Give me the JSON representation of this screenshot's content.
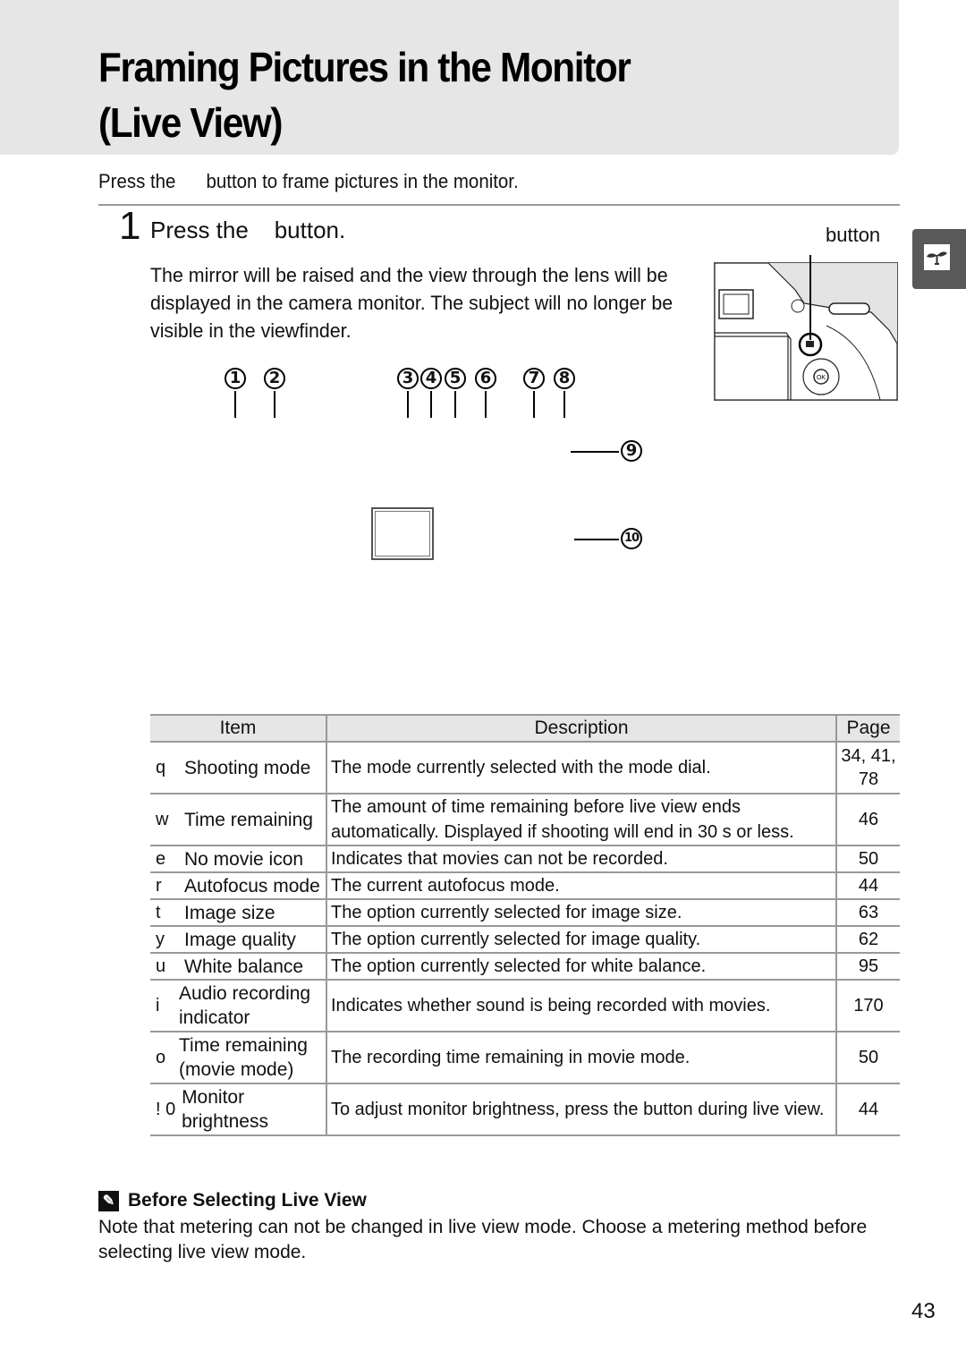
{
  "header": {
    "title_line1": "Framing Pictures in the Monitor",
    "title_line2": "(Live View)"
  },
  "intro": "Press the      button to frame pictures in the monitor.",
  "step": {
    "number": "1",
    "heading": "Press the    button.",
    "body": "The mirror will be raised and the view through the lens will be displayed in the camera monitor.  The subject will no longer be visible in the viewfinder.",
    "camera_callout_label": "button"
  },
  "diagram": {
    "callouts": [
      "1",
      "2",
      "3",
      "4",
      "5",
      "6",
      "7",
      "8",
      "9",
      "10"
    ]
  },
  "table": {
    "headers": [
      "Item",
      "Description",
      "Page"
    ],
    "rows": [
      {
        "key": "q",
        "item": "Shooting mode",
        "description": "The mode currently selected with the mode dial.",
        "page": "34, 41, 78"
      },
      {
        "key": "w",
        "item": "Time remaining",
        "description": "The amount of time remaining before live view ends automatically.  Displayed if shooting will end in 30 s or less.",
        "page": "46"
      },
      {
        "key": "e",
        "item": "No movie  icon",
        "description": "Indicates that movies can not be recorded.",
        "page": "50"
      },
      {
        "key": "r",
        "item": "Autofocus mode",
        "description": "The current autofocus mode.",
        "page": "44"
      },
      {
        "key": "t",
        "item": "Image size",
        "description": "The option currently selected for image size.",
        "page": "63"
      },
      {
        "key": "y",
        "item": "Image quality",
        "description": "The option currently selected for image quality.",
        "page": "62"
      },
      {
        "key": "u",
        "item": "White balance",
        "description": "The option currently selected for white balance.",
        "page": "95"
      },
      {
        "key": "i",
        "item": "Audio recording indicator",
        "description": "Indicates whether sound is being recorded with movies.",
        "page": "170"
      },
      {
        "key": "o",
        "item": "Time remaining (movie mode)",
        "description": "The recording time remaining in movie mode.",
        "page": "50"
      },
      {
        "key": "! 0",
        "item": "Monitor brightness",
        "description": "To adjust monitor brightness, press the      button during live view.",
        "page": "44"
      }
    ]
  },
  "tip": {
    "icon": "pencil-icon",
    "heading": "Before Selecting Live View",
    "body": "Note that metering can not be changed in live view mode.  Choose a metering method before selecting live view mode."
  },
  "side_tab": {
    "icon": "sprout-icon"
  },
  "page_number": "43"
}
